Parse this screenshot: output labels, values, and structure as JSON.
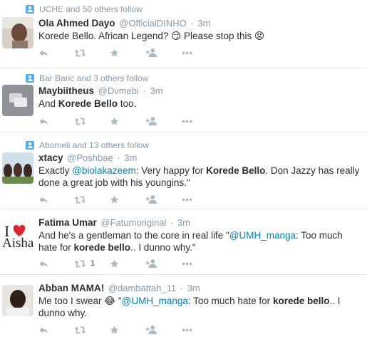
{
  "colors": {
    "link": "#0084b4",
    "muted": "#8899a6",
    "action_icon": "#aab8c2",
    "divider": "#e1e8ed"
  },
  "tweets": [
    {
      "context": "UCHE and 50 others follow",
      "fullname": "Ola Ahmed Dayo",
      "username": "@OfficialDINHO",
      "time": "3m",
      "text_parts": [
        "Korede Bello. African Legend? ",
        "😏",
        " Please stop this ",
        "😡"
      ],
      "retweet_count": ""
    },
    {
      "context": "Bar Baric and 3 others follow",
      "fullname": "Maybiitheus",
      "username": "@Dvmebi",
      "time": "3m",
      "text_parts": [
        "And ",
        "Korede Bello",
        " too."
      ],
      "retweet_count": ""
    },
    {
      "context": "Abomeli and 13 others follow",
      "fullname": "xtacy",
      "username": "@Poshbae",
      "time": "3m",
      "text_parts": [
        "Exactly ",
        "@biolakazeem",
        ": Very happy for ",
        "Korede Bello",
        ". Don Jazzy has really done a great job with his youngins.\""
      ],
      "retweet_count": ""
    },
    {
      "context": "",
      "fullname": "Fatima Umar",
      "username": "@Fatumoriginal",
      "time": "3m",
      "avatar_text": "Aisha",
      "text_parts": [
        "And he's a gentleman to the core in real life \"",
        "@UMH_manga",
        ": Too much hate for ",
        "korede bello",
        ".. I dunno why.\""
      ],
      "retweet_count": "1"
    },
    {
      "context": "",
      "fullname": "Abban MAMA!",
      "username": "@dambattah_11",
      "time": "3m",
      "text_parts": [
        "Me too I swear ",
        "😂",
        " \"",
        "@UMH_manga",
        ": Too much hate for ",
        "korede bello",
        ".. I dunno why."
      ],
      "retweet_count": ""
    }
  ],
  "actions": {
    "reply_icon": "reply-icon",
    "retweet_icon": "retweet-icon",
    "favorite_icon": "star-icon",
    "follow_icon": "follow-icon",
    "more_icon": "more-icon"
  }
}
